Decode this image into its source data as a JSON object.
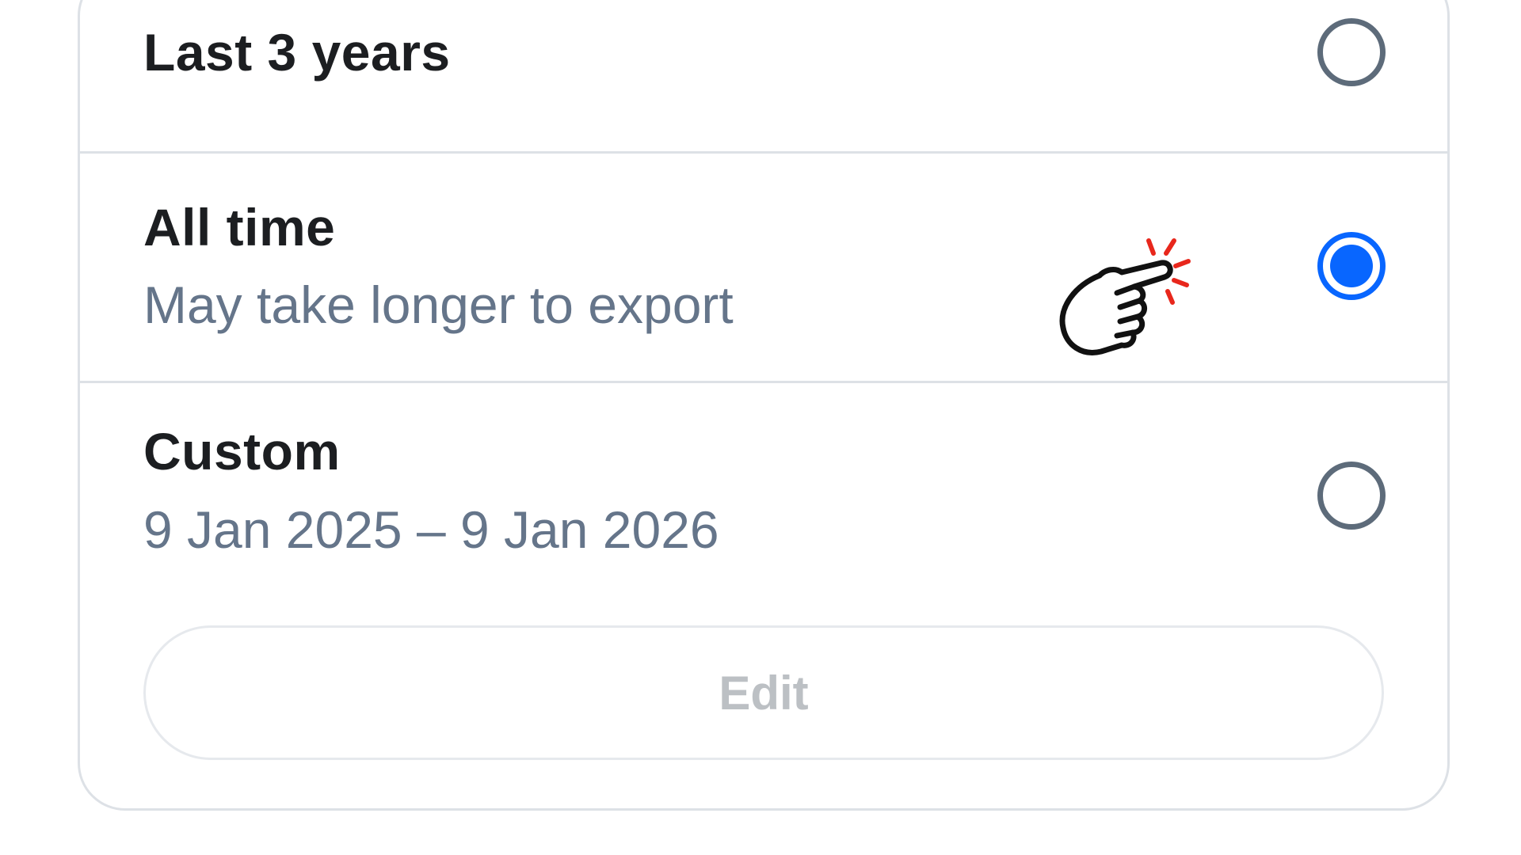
{
  "options": [
    {
      "title": "Last 3 years",
      "subtitle": "",
      "selected": false
    },
    {
      "title": "All time",
      "subtitle": "May take longer to export",
      "selected": true
    },
    {
      "title": "Custom",
      "subtitle": "9 Jan 2025 – 9 Jan 2026",
      "selected": false
    }
  ],
  "edit_label": "Edit",
  "colors": {
    "accent": "#0866ff",
    "title_text": "#1c1e21",
    "subtitle_text": "#65758a",
    "disabled_text": "#bcc0c4",
    "border": "#dde1e6",
    "click_burst": "#e8271c"
  },
  "icons": {
    "pointer": "hand-pointer-click-icon"
  }
}
